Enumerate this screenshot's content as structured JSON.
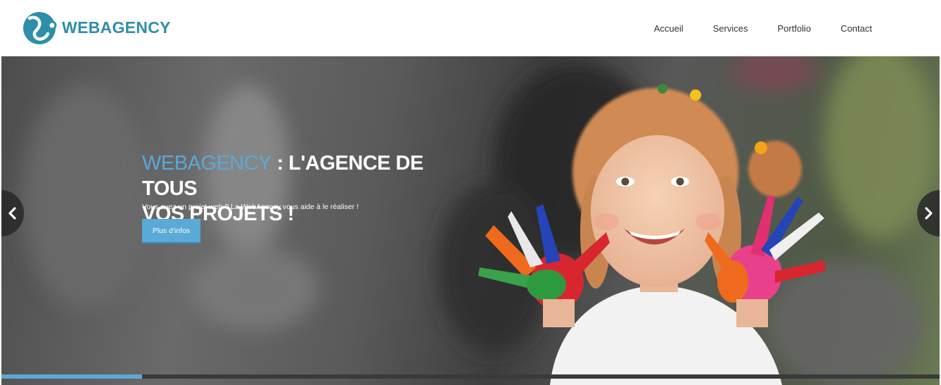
{
  "header": {
    "logo_text": "WEBAGENCY",
    "nav": [
      {
        "label": "Accueil"
      },
      {
        "label": "Services"
      },
      {
        "label": "Portfolio"
      },
      {
        "label": "Contact"
      }
    ]
  },
  "hero": {
    "title_brand": "WEBAGENCY",
    "title_rest_line1": " : L'AGENCE DE TOUS",
    "title_line2": "VOS PROJETS !",
    "subtitle": "Vous avez un projet web ? La WebAgency vous aide à le réaliser !",
    "button_label": "Plus d'infos",
    "slide_progress": 0.15
  },
  "icons": {
    "prev": "chevron-left-icon",
    "next": "chevron-right-icon"
  },
  "colors": {
    "brand": "#2f8fa8",
    "accent": "#5aa9d6",
    "nav_text": "#333333"
  }
}
